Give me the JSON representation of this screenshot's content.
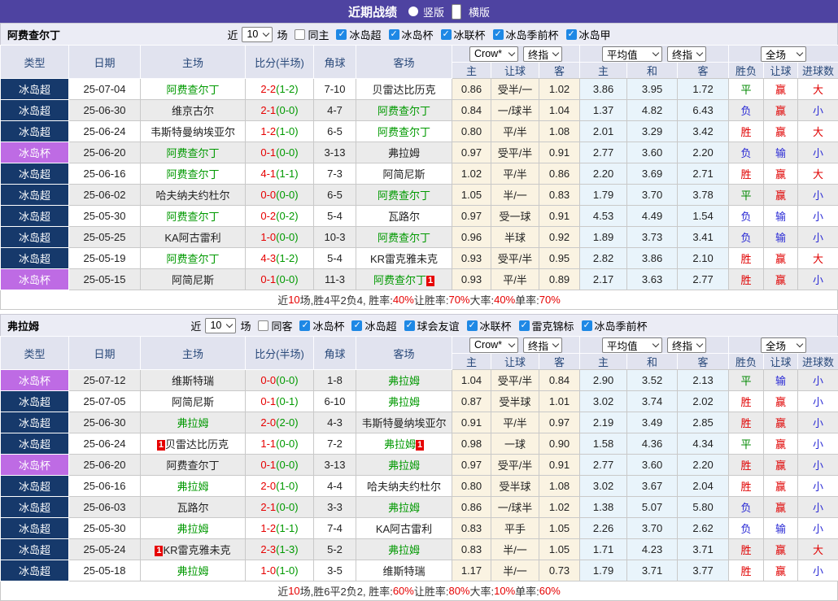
{
  "topbar": {
    "title": "近期战绩",
    "radios": [
      {
        "label": "竖版",
        "selected": false
      },
      {
        "label": "横版",
        "selected": true
      }
    ]
  },
  "table_header": {
    "type": "类型",
    "date": "日期",
    "home": "主场",
    "score": "比分(半场)",
    "corner": "角球",
    "away": "客场",
    "crow_select": "Crow*",
    "final_select": "终指",
    "avg_select": "平均值",
    "full_select": "全场",
    "odds_home": "主",
    "odds_handicap": "让球",
    "odds_away": "客",
    "avg_home": "主",
    "avg_draw": "和",
    "avg_away": "客",
    "result": "胜负",
    "handicap_result": "让球",
    "goals": "进球数"
  },
  "sections": [
    {
      "team": "阿费查尔丁",
      "filter": {
        "near": "近",
        "count": "10",
        "games": "场",
        "same": "同主",
        "same_checked": false,
        "leagues": [
          "冰岛超",
          "冰岛杯",
          "冰联杯",
          "冰岛季前杯",
          "冰岛甲"
        ]
      },
      "rows": [
        {
          "league": "冰岛超",
          "league_type": "super",
          "date": "25-07-04",
          "home": "阿费查尔丁",
          "home_team": true,
          "home_badge": "",
          "score_ft": "2-2",
          "score_ht": "(1-2)",
          "corner": "7-10",
          "away": "贝雷达比历克",
          "away_team": false,
          "away_badge": "",
          "odds": [
            "0.86",
            "受半/一",
            "1.02"
          ],
          "avg": [
            "3.86",
            "3.95",
            "1.72"
          ],
          "results": [
            "平",
            "赢",
            "大"
          ]
        },
        {
          "league": "冰岛超",
          "league_type": "super",
          "date": "25-06-30",
          "home": "维京古尔",
          "home_team": false,
          "home_badge": "",
          "score_ft": "2-1",
          "score_ht": "(0-0)",
          "corner": "4-7",
          "away": "阿费查尔丁",
          "away_team": true,
          "away_badge": "",
          "odds": [
            "0.84",
            "一/球半",
            "1.04"
          ],
          "avg": [
            "1.37",
            "4.82",
            "6.43"
          ],
          "results": [
            "负",
            "赢",
            "小"
          ]
        },
        {
          "league": "冰岛超",
          "league_type": "super",
          "date": "25-06-24",
          "home": "韦斯特曼纳埃亚尔",
          "home_team": false,
          "home_badge": "",
          "score_ft": "1-2",
          "score_ht": "(1-0)",
          "corner": "6-5",
          "away": "阿费查尔丁",
          "away_team": true,
          "away_badge": "",
          "odds": [
            "0.80",
            "平/半",
            "1.08"
          ],
          "avg": [
            "2.01",
            "3.29",
            "3.42"
          ],
          "results": [
            "胜",
            "赢",
            "大"
          ]
        },
        {
          "league": "冰岛杯",
          "league_type": "cup",
          "date": "25-06-20",
          "home": "阿费查尔丁",
          "home_team": true,
          "home_badge": "",
          "score_ft": "0-1",
          "score_ht": "(0-0)",
          "corner": "3-13",
          "away": "弗拉姆",
          "away_team": false,
          "away_badge": "",
          "odds": [
            "0.97",
            "受平/半",
            "0.91"
          ],
          "avg": [
            "2.77",
            "3.60",
            "2.20"
          ],
          "results": [
            "负",
            "输",
            "小"
          ]
        },
        {
          "league": "冰岛超",
          "league_type": "super",
          "date": "25-06-16",
          "home": "阿费查尔丁",
          "home_team": true,
          "home_badge": "",
          "score_ft": "4-1",
          "score_ht": "(1-1)",
          "corner": "7-3",
          "away": "阿简尼斯",
          "away_team": false,
          "away_badge": "",
          "odds": [
            "1.02",
            "平/半",
            "0.86"
          ],
          "avg": [
            "2.20",
            "3.69",
            "2.71"
          ],
          "results": [
            "胜",
            "赢",
            "大"
          ]
        },
        {
          "league": "冰岛超",
          "league_type": "super",
          "date": "25-06-02",
          "home": "哈夫纳夫约杜尔",
          "home_team": false,
          "home_badge": "",
          "score_ft": "0-0",
          "score_ht": "(0-0)",
          "corner": "6-5",
          "away": "阿费查尔丁",
          "away_team": true,
          "away_badge": "",
          "odds": [
            "1.05",
            "半/一",
            "0.83"
          ],
          "avg": [
            "1.79",
            "3.70",
            "3.78"
          ],
          "results": [
            "平",
            "赢",
            "小"
          ]
        },
        {
          "league": "冰岛超",
          "league_type": "super",
          "date": "25-05-30",
          "home": "阿费查尔丁",
          "home_team": true,
          "home_badge": "",
          "score_ft": "0-2",
          "score_ht": "(0-2)",
          "corner": "5-4",
          "away": "瓦路尔",
          "away_team": false,
          "away_badge": "",
          "odds": [
            "0.97",
            "受一球",
            "0.91"
          ],
          "avg": [
            "4.53",
            "4.49",
            "1.54"
          ],
          "results": [
            "负",
            "输",
            "小"
          ]
        },
        {
          "league": "冰岛超",
          "league_type": "super",
          "date": "25-05-25",
          "home": "KA阿古雷利",
          "home_team": false,
          "home_badge": "",
          "score_ft": "1-0",
          "score_ht": "(0-0)",
          "corner": "10-3",
          "away": "阿费查尔丁",
          "away_team": true,
          "away_badge": "",
          "odds": [
            "0.96",
            "半球",
            "0.92"
          ],
          "avg": [
            "1.89",
            "3.73",
            "3.41"
          ],
          "results": [
            "负",
            "输",
            "小"
          ]
        },
        {
          "league": "冰岛超",
          "league_type": "super",
          "date": "25-05-19",
          "home": "阿费查尔丁",
          "home_team": true,
          "home_badge": "",
          "score_ft": "4-3",
          "score_ht": "(1-2)",
          "corner": "5-4",
          "away": "KR雷克雅未克",
          "away_team": false,
          "away_badge": "",
          "odds": [
            "0.93",
            "受平/半",
            "0.95"
          ],
          "avg": [
            "2.82",
            "3.86",
            "2.10"
          ],
          "results": [
            "胜",
            "赢",
            "大"
          ]
        },
        {
          "league": "冰岛杯",
          "league_type": "cup",
          "date": "25-05-15",
          "home": "阿简尼斯",
          "home_team": false,
          "home_badge": "",
          "score_ft": "0-1",
          "score_ht": "(0-0)",
          "corner": "11-3",
          "away": "阿费查尔丁",
          "away_team": true,
          "away_badge": "1",
          "odds": [
            "0.93",
            "平/半",
            "0.89"
          ],
          "avg": [
            "2.17",
            "3.63",
            "2.77"
          ],
          "results": [
            "胜",
            "赢",
            "小"
          ]
        }
      ],
      "summary": [
        {
          "t": "近",
          "red": false
        },
        {
          "t": "10",
          "red": true
        },
        {
          "t": "场,胜4平2负4, 胜率:",
          "red": false
        },
        {
          "t": "40%",
          "red": true
        },
        {
          "t": " 让胜率:",
          "red": false
        },
        {
          "t": "70%",
          "red": true
        },
        {
          "t": " 大率:",
          "red": false
        },
        {
          "t": "40%",
          "red": true
        },
        {
          "t": " 单率:",
          "red": false
        },
        {
          "t": "70%",
          "red": true
        }
      ]
    },
    {
      "team": "弗拉姆",
      "filter": {
        "near": "近",
        "count": "10",
        "games": "场",
        "same": "同客",
        "same_checked": false,
        "leagues": [
          "冰岛杯",
          "冰岛超",
          "球会友谊",
          "冰联杯",
          "雷克锦标",
          "冰岛季前杯"
        ]
      },
      "rows": [
        {
          "league": "冰岛杯",
          "league_type": "cup",
          "date": "25-07-12",
          "home": "维斯特瑞",
          "home_team": false,
          "home_badge": "",
          "score_ft": "0-0",
          "score_ht": "(0-0)",
          "corner": "1-8",
          "away": "弗拉姆",
          "away_team": true,
          "away_badge": "",
          "odds": [
            "1.04",
            "受平/半",
            "0.84"
          ],
          "avg": [
            "2.90",
            "3.52",
            "2.13"
          ],
          "results": [
            "平",
            "输",
            "小"
          ]
        },
        {
          "league": "冰岛超",
          "league_type": "super",
          "date": "25-07-05",
          "home": "阿简尼斯",
          "home_team": false,
          "home_badge": "",
          "score_ft": "0-1",
          "score_ht": "(0-1)",
          "corner": "6-10",
          "away": "弗拉姆",
          "away_team": true,
          "away_badge": "",
          "odds": [
            "0.87",
            "受半球",
            "1.01"
          ],
          "avg": [
            "3.02",
            "3.74",
            "2.02"
          ],
          "results": [
            "胜",
            "赢",
            "小"
          ]
        },
        {
          "league": "冰岛超",
          "league_type": "super",
          "date": "25-06-30",
          "home": "弗拉姆",
          "home_team": true,
          "home_badge": "",
          "score_ft": "2-0",
          "score_ht": "(2-0)",
          "corner": "4-3",
          "away": "韦斯特曼纳埃亚尔",
          "away_team": false,
          "away_badge": "",
          "odds": [
            "0.91",
            "平/半",
            "0.97"
          ],
          "avg": [
            "2.19",
            "3.49",
            "2.85"
          ],
          "results": [
            "胜",
            "赢",
            "小"
          ]
        },
        {
          "league": "冰岛超",
          "league_type": "super",
          "date": "25-06-24",
          "home": "贝雷达比历克",
          "home_team": false,
          "home_badge": "1",
          "score_ft": "1-1",
          "score_ht": "(0-0)",
          "corner": "7-2",
          "away": "弗拉姆",
          "away_team": true,
          "away_badge": "1",
          "odds": [
            "0.98",
            "一球",
            "0.90"
          ],
          "avg": [
            "1.58",
            "4.36",
            "4.34"
          ],
          "results": [
            "平",
            "赢",
            "小"
          ]
        },
        {
          "league": "冰岛杯",
          "league_type": "cup",
          "date": "25-06-20",
          "home": "阿费查尔丁",
          "home_team": false,
          "home_badge": "",
          "score_ft": "0-1",
          "score_ht": "(0-0)",
          "corner": "3-13",
          "away": "弗拉姆",
          "away_team": true,
          "away_badge": "",
          "odds": [
            "0.97",
            "受平/半",
            "0.91"
          ],
          "avg": [
            "2.77",
            "3.60",
            "2.20"
          ],
          "results": [
            "胜",
            "赢",
            "小"
          ]
        },
        {
          "league": "冰岛超",
          "league_type": "super",
          "date": "25-06-16",
          "home": "弗拉姆",
          "home_team": true,
          "home_badge": "",
          "score_ft": "2-0",
          "score_ht": "(1-0)",
          "corner": "4-4",
          "away": "哈夫纳夫约杜尔",
          "away_team": false,
          "away_badge": "",
          "odds": [
            "0.80",
            "受半球",
            "1.08"
          ],
          "avg": [
            "3.02",
            "3.67",
            "2.04"
          ],
          "results": [
            "胜",
            "赢",
            "小"
          ]
        },
        {
          "league": "冰岛超",
          "league_type": "super",
          "date": "25-06-03",
          "home": "瓦路尔",
          "home_team": false,
          "home_badge": "",
          "score_ft": "2-1",
          "score_ht": "(0-0)",
          "corner": "3-3",
          "away": "弗拉姆",
          "away_team": true,
          "away_badge": "",
          "odds": [
            "0.86",
            "一/球半",
            "1.02"
          ],
          "avg": [
            "1.38",
            "5.07",
            "5.80"
          ],
          "results": [
            "负",
            "赢",
            "小"
          ]
        },
        {
          "league": "冰岛超",
          "league_type": "super",
          "date": "25-05-30",
          "home": "弗拉姆",
          "home_team": true,
          "home_badge": "",
          "score_ft": "1-2",
          "score_ht": "(1-1)",
          "corner": "7-4",
          "away": "KA阿古雷利",
          "away_team": false,
          "away_badge": "",
          "odds": [
            "0.83",
            "平手",
            "1.05"
          ],
          "avg": [
            "2.26",
            "3.70",
            "2.62"
          ],
          "results": [
            "负",
            "输",
            "小"
          ]
        },
        {
          "league": "冰岛超",
          "league_type": "super",
          "date": "25-05-24",
          "home": "KR雷克雅未克",
          "home_team": false,
          "home_badge": "1",
          "score_ft": "2-3",
          "score_ht": "(1-3)",
          "corner": "5-2",
          "away": "弗拉姆",
          "away_team": true,
          "away_badge": "",
          "odds": [
            "0.83",
            "半/一",
            "1.05"
          ],
          "avg": [
            "1.71",
            "4.23",
            "3.71"
          ],
          "results": [
            "胜",
            "赢",
            "大"
          ]
        },
        {
          "league": "冰岛超",
          "league_type": "super",
          "date": "25-05-18",
          "home": "弗拉姆",
          "home_team": true,
          "home_badge": "",
          "score_ft": "1-0",
          "score_ht": "(1-0)",
          "corner": "3-5",
          "away": "维斯特瑞",
          "away_team": false,
          "away_badge": "",
          "odds": [
            "1.17",
            "半/一",
            "0.73"
          ],
          "avg": [
            "1.79",
            "3.71",
            "3.77"
          ],
          "results": [
            "胜",
            "赢",
            "小"
          ]
        }
      ],
      "summary": [
        {
          "t": "近",
          "red": false
        },
        {
          "t": "10",
          "red": true
        },
        {
          "t": "场,胜6平2负2, 胜率:",
          "red": false
        },
        {
          "t": "60%",
          "red": true
        },
        {
          "t": " 让胜率:",
          "red": false
        },
        {
          "t": "80%",
          "red": true
        },
        {
          "t": " 大率:",
          "red": false
        },
        {
          "t": "10%",
          "red": true
        },
        {
          "t": " 单率:",
          "red": false
        },
        {
          "t": "60%",
          "red": true
        }
      ]
    }
  ]
}
